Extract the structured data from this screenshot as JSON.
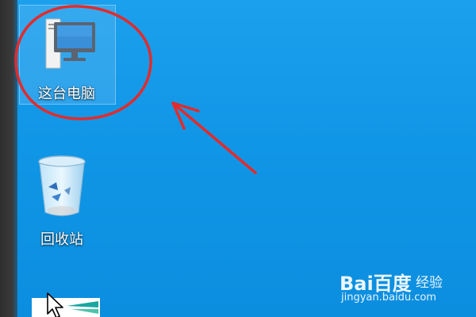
{
  "desktop": {
    "icons": [
      {
        "label": "这台电脑",
        "icon": "computer-icon"
      },
      {
        "label": "回收站",
        "icon": "recycle-bin-icon"
      },
      {
        "label": "",
        "icon": "partial-icon"
      }
    ]
  },
  "annotation": {
    "color": "#e32b2b",
    "shapes": [
      "ellipse",
      "arrow"
    ]
  },
  "watermark": {
    "brand": "Bai百度",
    "suffix": "经验",
    "url": "jingyan.baidu.com"
  }
}
